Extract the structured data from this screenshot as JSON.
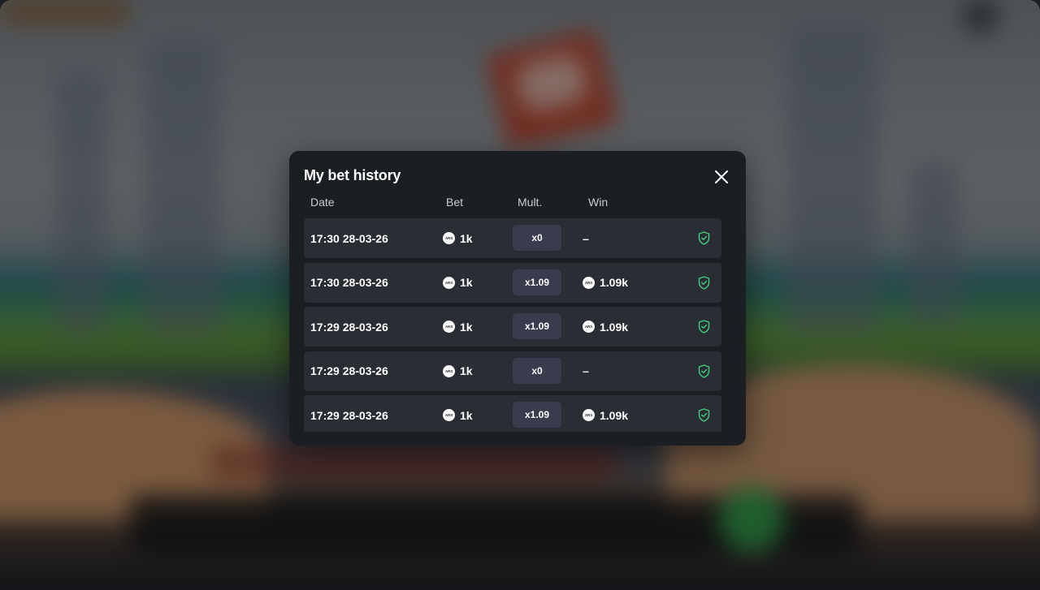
{
  "modal": {
    "title": "My bet history",
    "close_icon": "close-icon",
    "columns": {
      "date": "Date",
      "bet": "Bet",
      "mult": "Mult.",
      "win": "Win"
    },
    "currency_code": "ARS",
    "rows": [
      {
        "date": "17:30 28-03-26",
        "bet": "1k",
        "mult": "x0",
        "win": "–",
        "verify_icon": "shield-check-icon"
      },
      {
        "date": "17:30 28-03-26",
        "bet": "1k",
        "mult": "x1.09",
        "win": "1.09k",
        "verify_icon": "shield-check-icon"
      },
      {
        "date": "17:29 28-03-26",
        "bet": "1k",
        "mult": "x1.09",
        "win": "1.09k",
        "verify_icon": "shield-check-icon"
      },
      {
        "date": "17:29 28-03-26",
        "bet": "1k",
        "mult": "x0",
        "win": "–",
        "verify_icon": "shield-check-icon"
      },
      {
        "date": "17:29 28-03-26",
        "bet": "1k",
        "mult": "x1.09",
        "win": "1.09k",
        "verify_icon": "shield-check-icon"
      }
    ]
  },
  "colors": {
    "modal_bg": "#1b1e23",
    "row_bg": "#2a2d34",
    "mult_pill_bg": "#3a3b4d",
    "shield_green": "#3fcf7a"
  }
}
